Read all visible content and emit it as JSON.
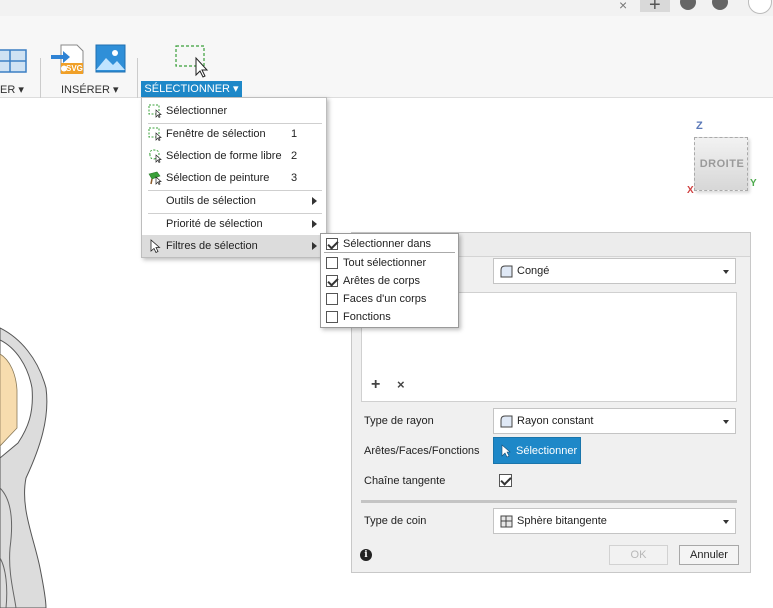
{
  "window": {
    "close_glyph": "×"
  },
  "toolbar": {
    "groups": [
      {
        "label": "ER ▾"
      },
      {
        "label": "INSÉRER ▾"
      },
      {
        "label": "SÉLECTIONNER ▾"
      }
    ],
    "icons": [
      "assemble-icon",
      "insert-svg-icon",
      "insert-image-icon",
      "select-window-icon"
    ],
    "svg_badge": "SVG"
  },
  "select_menu": {
    "items": [
      {
        "label": "Sélectionner",
        "shortcut": "",
        "submenu": false
      },
      {
        "label": "Fenêtre de sélection",
        "shortcut": "1",
        "submenu": false
      },
      {
        "label": "Sélection de forme libre",
        "shortcut": "2",
        "submenu": false
      },
      {
        "label": "Sélection de peinture",
        "shortcut": "3",
        "submenu": false
      },
      {
        "label": "Outils de sélection",
        "shortcut": "",
        "submenu": true
      },
      {
        "label": "Priorité de sélection",
        "shortcut": "",
        "submenu": true
      },
      {
        "label": "Filtres de sélection",
        "shortcut": "",
        "submenu": true,
        "highlighted": true
      }
    ]
  },
  "filter_submenu": {
    "items": [
      {
        "label": "Sélectionner dans",
        "checked": true
      },
      {
        "label": "Tout sélectionner",
        "checked": false
      },
      {
        "label": "Arêtes de corps",
        "checked": true
      },
      {
        "label": "Faces d'un corps",
        "checked": false
      },
      {
        "label": "Fonctions",
        "checked": false
      }
    ]
  },
  "fillet_dialog": {
    "type_value": "Congé",
    "add_glyph": "+",
    "remove_glyph": "×",
    "radius_type_label": "Type de rayon",
    "radius_type_value": "Rayon constant",
    "edges_label": "Arêtes/Faces/Fonctions",
    "select_button": "Sélectionner",
    "tangent_chain_label": "Chaîne tangente",
    "tangent_chain_checked": true,
    "corner_type_label": "Type de coin",
    "corner_type_value": "Sphère bitangente",
    "info_glyph": "i",
    "ok_label": "OK",
    "cancel_label": "Annuler"
  },
  "view_cube": {
    "face": "DROITE",
    "axis_z": "Z",
    "axis_y": "Y",
    "axis_x": "X"
  },
  "colors": {
    "accent": "#1e88c8",
    "part_fill": "#f7dcae",
    "part_shell": "#dcdcdc"
  }
}
